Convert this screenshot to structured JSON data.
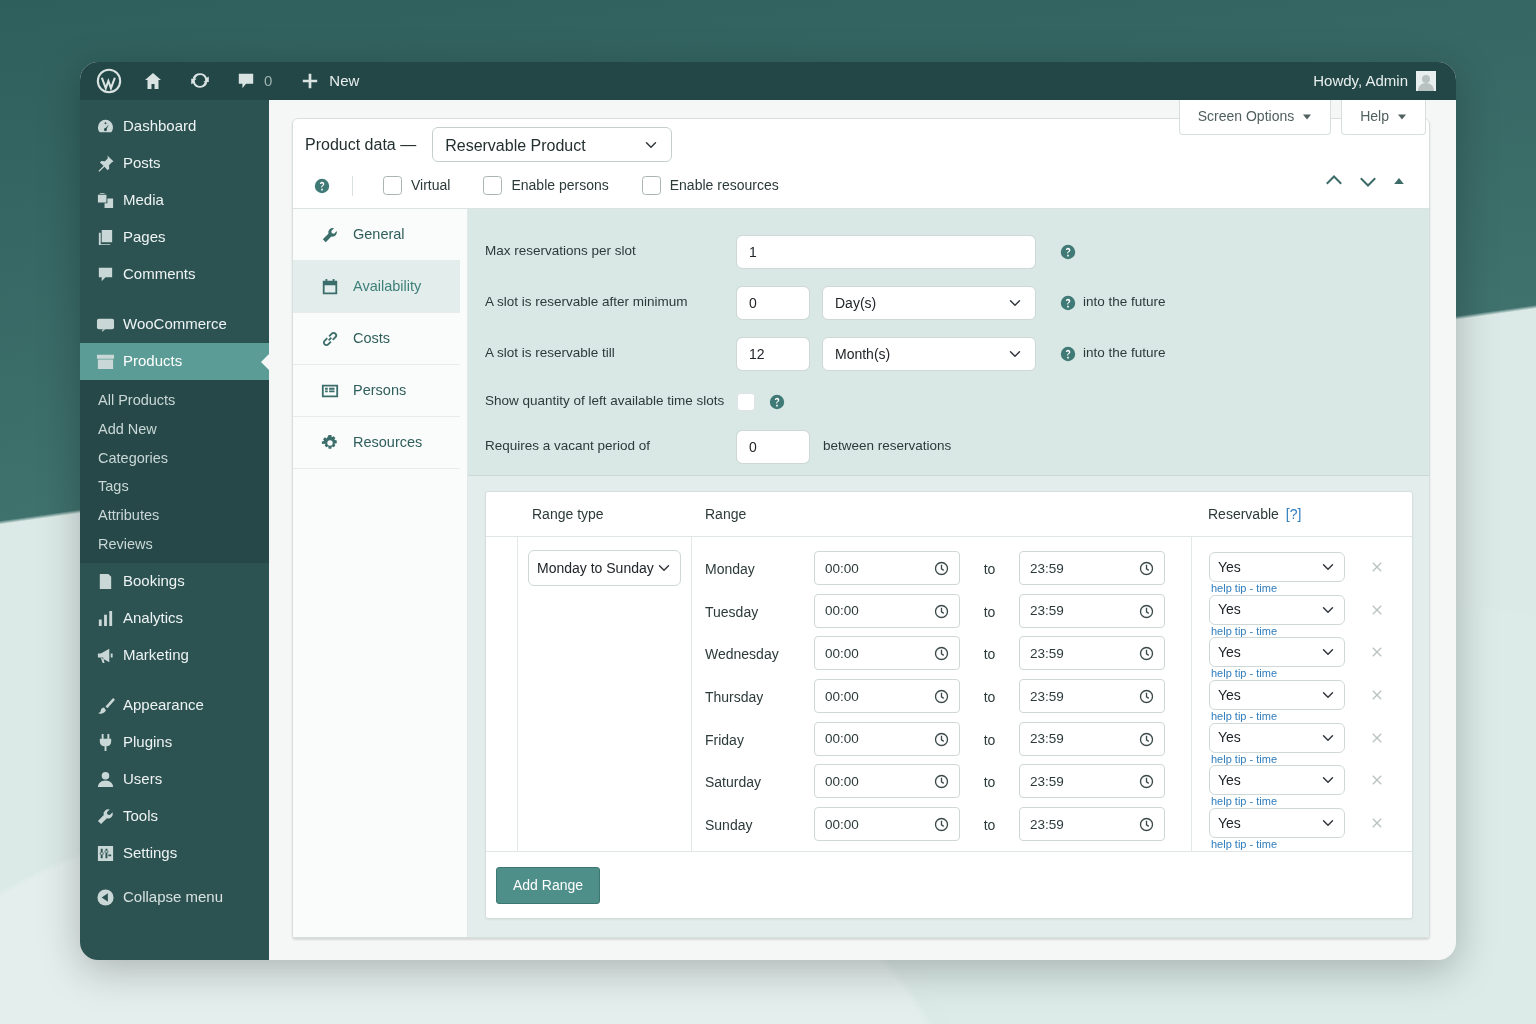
{
  "admin_bar": {
    "comments_count": "0",
    "new_label": "New",
    "greeting": "Howdy, Admin"
  },
  "sidebar": {
    "sections": [
      {
        "items": [
          {
            "label": "Dashboard",
            "selected": false
          },
          {
            "label": "Posts",
            "selected": false
          },
          {
            "label": "Media",
            "selected": false
          },
          {
            "label": "Pages",
            "selected": false
          },
          {
            "label": "Comments",
            "selected": false
          }
        ]
      },
      {
        "items": [
          {
            "label": "WooCommerce",
            "selected": false
          },
          {
            "label": "Products",
            "selected": true,
            "children": [
              {
                "label": "All Products",
                "selected": false
              },
              {
                "label": "Add New",
                "selected": false
              },
              {
                "label": "Categories",
                "selected": false
              },
              {
                "label": "Tags",
                "selected": false
              },
              {
                "label": "Attributes",
                "selected": false
              },
              {
                "label": "Reviews",
                "selected": false
              }
            ]
          },
          {
            "label": "Bookings",
            "selected": false
          },
          {
            "label": "Analytics",
            "selected": false
          },
          {
            "label": "Marketing",
            "selected": false
          }
        ]
      },
      {
        "items": [
          {
            "label": "Appearance",
            "selected": false
          },
          {
            "label": "Plugins",
            "selected": false
          },
          {
            "label": "Users",
            "selected": false
          },
          {
            "label": "Tools",
            "selected": false
          },
          {
            "label": "Settings",
            "selected": false
          }
        ]
      }
    ],
    "collapse": "Collapse menu"
  },
  "screen_meta": [
    "Screen Options",
    "Help"
  ],
  "product_data": {
    "title": "Product data —",
    "type": "Reservable Product",
    "options": [
      {
        "label": "Virtual",
        "checked": false
      },
      {
        "label": "Enable persons",
        "checked": false
      },
      {
        "label": "Enable resources",
        "checked": false
      }
    ],
    "tabs": [
      {
        "label": "General",
        "selected": false
      },
      {
        "label": "Availability",
        "selected": true
      },
      {
        "label": "Costs",
        "selected": false
      },
      {
        "label": "Persons",
        "selected": false
      },
      {
        "label": "Resources",
        "selected": false
      }
    ],
    "fields": [
      {
        "kind": "text",
        "label": "Max reservations per slot",
        "value": "1",
        "help": true
      },
      {
        "kind": "number_unit",
        "label": "A slot is reservable after minimum",
        "value": "0",
        "unit": "Day(s)",
        "help": true,
        "note": "into the future"
      },
      {
        "kind": "number_unit",
        "label": "A slot is reservable till",
        "value": "12",
        "unit": "Month(s)",
        "help": true,
        "note": "into the future"
      },
      {
        "kind": "checkbox",
        "label": "Show quantity of left available time slots",
        "checked": false,
        "help": true
      },
      {
        "kind": "number",
        "label": "Requires a vacant period of",
        "value": "0",
        "help": false,
        "note": "between reservations"
      }
    ],
    "range_table": {
      "columns": [
        "Range type",
        "Range",
        "Reservable"
      ],
      "reservable_hint": "[?]",
      "range_type": "Monday to Sunday",
      "rows": [
        {
          "day": "Monday",
          "from": "00:00",
          "separator": "to",
          "until": "23:59",
          "reservable": "Yes",
          "help": "help tip - time"
        },
        {
          "day": "Tuesday",
          "from": "00:00",
          "separator": "to",
          "until": "23:59",
          "reservable": "Yes",
          "help": "help tip - time"
        },
        {
          "day": "Wednesday",
          "from": "00:00",
          "separator": "to",
          "until": "23:59",
          "reservable": "Yes",
          "help": "help tip - time"
        },
        {
          "day": "Thursday",
          "from": "00:00",
          "separator": "to",
          "until": "23:59",
          "reservable": "Yes",
          "help": "help tip - time"
        },
        {
          "day": "Friday",
          "from": "00:00",
          "separator": "to",
          "until": "23:59",
          "reservable": "Yes",
          "help": "help tip - time"
        },
        {
          "day": "Saturday",
          "from": "00:00",
          "separator": "to",
          "until": "23:59",
          "reservable": "Yes",
          "help": "help tip - time"
        },
        {
          "day": "Sunday",
          "from": "00:00",
          "separator": "to",
          "until": "23:59",
          "reservable": "Yes",
          "help": "help tip - time"
        }
      ],
      "add_button": "Add Range"
    }
  }
}
